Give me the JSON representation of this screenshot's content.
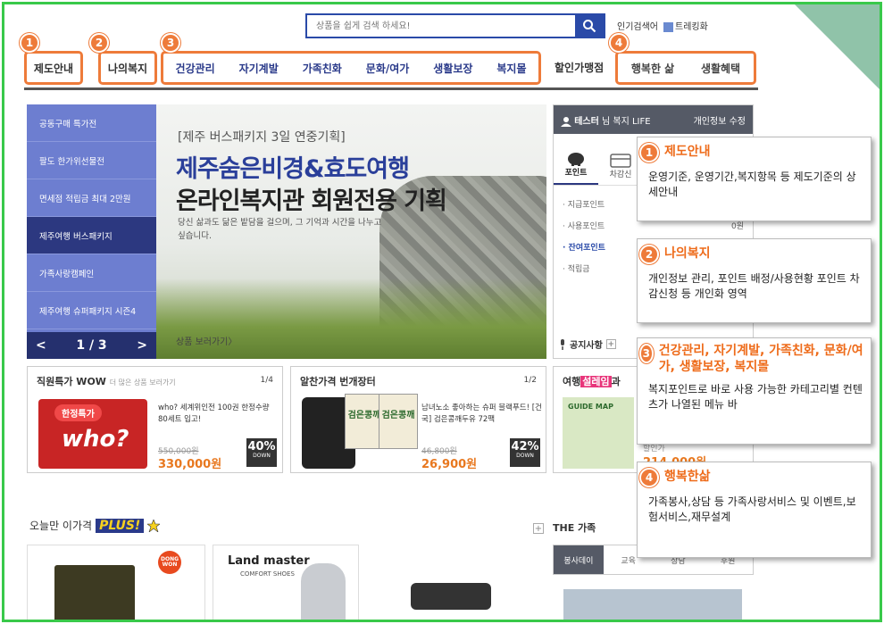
{
  "search": {
    "placeholder": "상품을 쉽게 검색 하세요!"
  },
  "top_links": {
    "popular": "인기검색어",
    "trending": "트레킹화"
  },
  "gnb": {
    "g1": [
      "제도안내"
    ],
    "g2": [
      "나의복지"
    ],
    "g3": [
      "건강관리",
      "자기계발",
      "가족친화",
      "문화/여가",
      "생활보장",
      "복지몰"
    ],
    "plain": "할인가맹점",
    "g4": [
      "행복한 삶",
      "생활혜택"
    ]
  },
  "badges": [
    "1",
    "2",
    "3",
    "4"
  ],
  "side_menu": {
    "items": [
      "공동구매 특가전",
      "팔도 한가위선물전",
      "면세점 적립금 최대 2만원",
      "제주여행 버스패키지",
      "가족사랑캠페인",
      "제주여행 슈퍼패키지 시즌4"
    ],
    "active_index": 3,
    "pager": "1 / 3",
    "prev": "<",
    "next": ">"
  },
  "hero": {
    "subtitle": "[제주 버스패키지 3일 연중기획]",
    "title1": "제주숨은비경&효도여행",
    "title2": "온라인복지관 회원전용 기획",
    "desc": "당신 삶과도 닮은 밭담을 걸으며, 그 기억과 시간을 나누고 싶습니다.",
    "link": "상품 보러가기〉"
  },
  "member": {
    "name": "테스터",
    "suffix": "님 복지 LIFE",
    "edit": "개인정보 수정",
    "tabs": [
      "포인트",
      "차감신"
    ],
    "points": [
      {
        "label": "· 지급포인트",
        "value": ""
      },
      {
        "label": "· 사용포인트",
        "value": "0원"
      },
      {
        "label": "· 잔여포인트",
        "value": ""
      },
      {
        "label": "· 적립금",
        "value": ""
      }
    ],
    "notice": "공지사항"
  },
  "promos": [
    {
      "title": "직원특가 WOW",
      "more": "더 많은 상품 보러가기",
      "page": "1/4",
      "desc": "who? 세계위인전 100권 한정수량 80세트 입고!",
      "tag": "한정특가",
      "old": "550,000원",
      "price": "330,000원",
      "pct": "40",
      "down": "DOWN"
    },
    {
      "title": "알찬가격 번개장터",
      "page": "1/2",
      "desc": "남녀노소 좋아하는 슈퍼 블랙푸드! [건국] 검은콩깨두유 72팩",
      "product": "검은콩깨",
      "old": "46,800원",
      "price": "26,900원",
      "pct": "42",
      "down": "DOWN"
    },
    {
      "title_prefix": "여행",
      "title_tag": "설레임",
      "title_suffix": "과",
      "product": "GUIDE MAP",
      "price": "214,000원",
      "old": "할인가"
    }
  ],
  "bottom": {
    "title": "오늘만 이가격",
    "plus": "PLUS!",
    "brand1": "DONG WON",
    "brand2": "Land master",
    "brand2_sub": "COMFORT SHOES",
    "the_family": "THE 가족",
    "tabs": [
      "봉사데이",
      "교육",
      "상담",
      "후원"
    ]
  },
  "callouts": [
    {
      "num": "1",
      "title": "제도안내",
      "body": "운영기준, 운영기간,복지항목 등 제도기준의 상세안내"
    },
    {
      "num": "2",
      "title": "나의복지",
      "body": "개인정보 관리, 포인트 배정/사용현황 포인트 차감신청 등 개인화 영역"
    },
    {
      "num": "3",
      "title": "건강관리, 자기계발, 가족친화, 문화/여가, 생활보장, 복지몰",
      "body": "복지포인트로 바로 사용 가능한 카테고리별 컨텐츠가 나열된 메뉴 바"
    },
    {
      "num": "4",
      "title": "행복한삶",
      "body": "가족봉사,상담 등 가족사랑서비스 및 이벤트,보험서비스,재무설계"
    }
  ],
  "colors": {
    "accent": "#ee7b3a",
    "navy": "#2a3a8a",
    "frame": "#39c94a"
  }
}
